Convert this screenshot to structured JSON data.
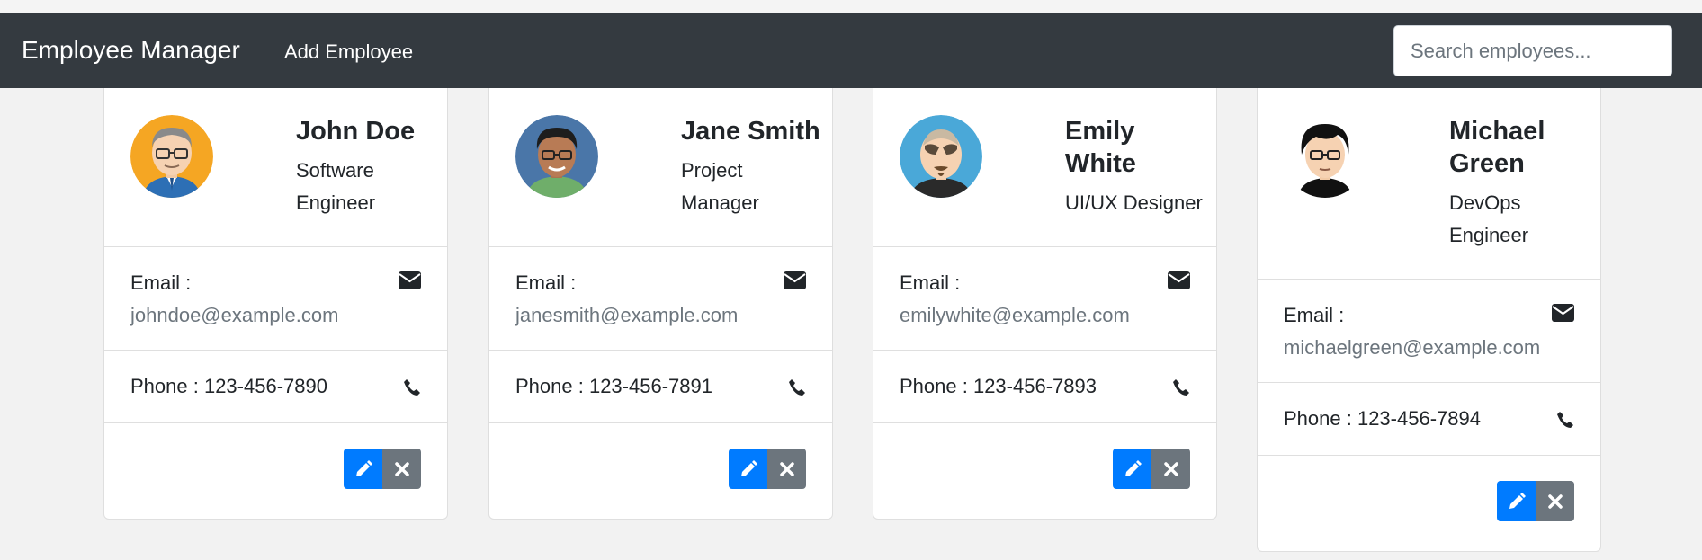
{
  "navbar": {
    "brand": "Employee Manager",
    "add_link": "Add Employee",
    "search_placeholder": "Search employees..."
  },
  "colors": {
    "navbar": "#343a40",
    "edit_button": "#007bff",
    "delete_button": "#6c757d"
  },
  "employees": [
    {
      "name": "John Doe",
      "title": "Software Engineer",
      "email_label": "Email :",
      "email": "johndoe@example.com",
      "phone": "Phone : 123-456-7890",
      "avatar_bg": "#f5a623"
    },
    {
      "name": "Jane Smith",
      "title": "Project Manager",
      "email_label": "Email :",
      "email": "janesmith@example.com",
      "phone": "Phone : 123-456-7891",
      "avatar_bg": "#4a76a8"
    },
    {
      "name": "Emily White",
      "title": "UI/UX Designer",
      "email_label": "Email :",
      "email": "emilywhite@example.com",
      "phone": "Phone : 123-456-7893",
      "avatar_bg": "#4aa8d8"
    },
    {
      "name": "Michael Green",
      "title": "DevOps Engineer",
      "email_label": "Email :",
      "email": "michaelgreen@example.com",
      "phone": "Phone : 123-456-7894",
      "avatar_bg": "#ffffff"
    }
  ],
  "icons": {
    "email": "envelope-icon",
    "phone": "phone-icon",
    "edit": "pencil-icon",
    "delete": "x-icon"
  }
}
